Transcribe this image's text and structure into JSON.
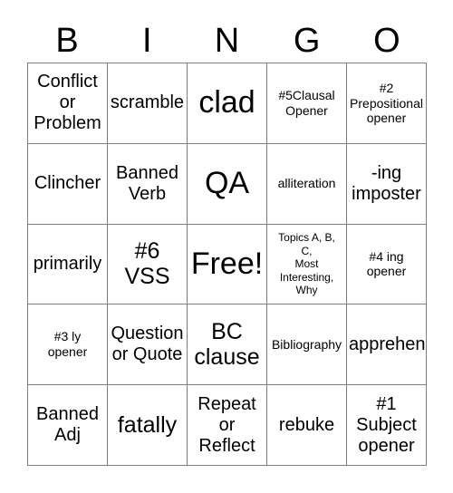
{
  "card": {
    "title": "BINGO",
    "header_letters": [
      "B",
      "I",
      "N",
      "G",
      "O"
    ],
    "free_space_label": "Free!",
    "colors": {
      "background": "#ffffff",
      "text": "#000000",
      "grid_line": "#808080"
    },
    "rows": [
      [
        {
          "text": "Conflict\nor\nProblem",
          "size": "md"
        },
        {
          "text": "scramble",
          "size": "md"
        },
        {
          "text": "clad",
          "size": "xl"
        },
        {
          "text": "#5Clausal\nOpener",
          "size": "sm"
        },
        {
          "text": "#2\nPrepositional\nopener",
          "size": "sm"
        }
      ],
      [
        {
          "text": "Clincher",
          "size": "md"
        },
        {
          "text": "Banned\nVerb",
          "size": "md"
        },
        {
          "text": "QA",
          "size": "xl"
        },
        {
          "text": "alliteration",
          "size": "sm"
        },
        {
          "text": "-ing\nimposter",
          "size": "md"
        }
      ],
      [
        {
          "text": "primarily",
          "size": "md"
        },
        {
          "text": "#6\nVSS",
          "size": "lg"
        },
        {
          "text": "Free!",
          "size": "xl"
        },
        {
          "text": "Topics A, B,\nC,\nMost\nInteresting,\nWhy",
          "size": "xs"
        },
        {
          "text": "#4 ing\nopener",
          "size": "sm"
        }
      ],
      [
        {
          "text": "#3 ly\nopener",
          "size": "sm"
        },
        {
          "text": "Question\nor Quote",
          "size": "md"
        },
        {
          "text": "BC\nclause",
          "size": "lg"
        },
        {
          "text": "Bibliography",
          "size": "sm"
        },
        {
          "text": "apprehend",
          "size": "md"
        }
      ],
      [
        {
          "text": "Banned\nAdj",
          "size": "md"
        },
        {
          "text": "fatally",
          "size": "lg"
        },
        {
          "text": "Repeat\nor\nReflect",
          "size": "md"
        },
        {
          "text": "rebuke",
          "size": "md"
        },
        {
          "text": "#1\nSubject\nopener",
          "size": "md"
        }
      ]
    ]
  }
}
